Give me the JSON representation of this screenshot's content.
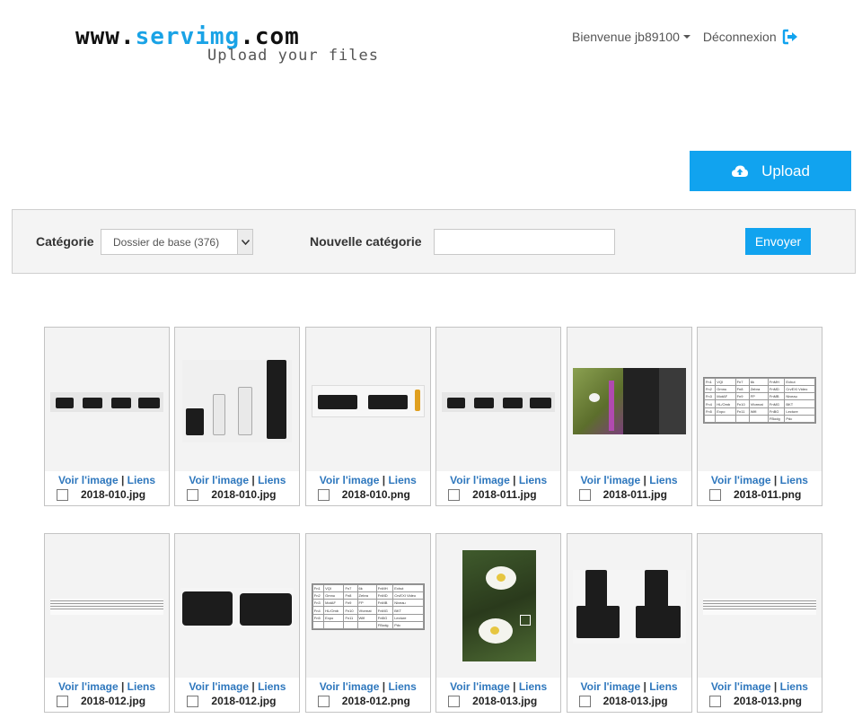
{
  "brand": {
    "prefix": "www.",
    "name": "servimg",
    "suffix": ".com",
    "tagline": "Upload your files"
  },
  "nav": {
    "welcome": "Bienvenue jb89100",
    "logout": "Déconnexion"
  },
  "upload": {
    "label": "Upload"
  },
  "category_panel": {
    "category_label": "Catégorie",
    "selected_category": "Dossier de base (376)",
    "new_category_label": "Nouvelle catégorie",
    "new_category_value": "",
    "send_label": "Envoyer"
  },
  "card_labels": {
    "view": "Voir l'image",
    "separator": "|",
    "links": "Liens"
  },
  "files": [
    {
      "name": "2018-010.jpg",
      "thumb": "cameras-row"
    },
    {
      "name": "2018-010.jpg",
      "thumb": "lenses"
    },
    {
      "name": "2018-010.png",
      "thumb": "cameras-top"
    },
    {
      "name": "2018-011.jpg",
      "thumb": "cameras-row"
    },
    {
      "name": "2018-011.jpg",
      "thumb": "butterfly-screen"
    },
    {
      "name": "2018-011.png",
      "thumb": "table"
    },
    {
      "name": "2018-012.jpg",
      "thumb": "text-table"
    },
    {
      "name": "2018-012.jpg",
      "thumb": "two-cameras"
    },
    {
      "name": "2018-012.png",
      "thumb": "table"
    },
    {
      "name": "2018-013.jpg",
      "thumb": "flowers"
    },
    {
      "name": "2018-013.jpg",
      "thumb": "cameras-lenses"
    },
    {
      "name": "2018-013.png",
      "thumb": "text-table"
    }
  ],
  "thumb_table_cells": [
    [
      "Fn1",
      "VQI",
      "Fn7",
      "6k",
      "FnMH",
      "Exhut"
    ],
    [
      "Fn2",
      "Gmnu",
      "Fn8",
      "Zebra",
      "FnMD",
      "CrvEXI Video"
    ],
    [
      "Fn3",
      "MotAF",
      "Fn9",
      "FP",
      "FnMB",
      "Niveau"
    ],
    [
      "Fn4",
      "HL/Omb",
      "Fn10",
      "Vformat",
      "FnMG",
      "BKT"
    ],
    [
      "Fn5",
      "Expo",
      "Fn11",
      "Wifi",
      "FnBG",
      "Lecture"
    ],
    [
      "",
      "",
      "",
      "",
      "FBodg",
      "Pdc"
    ]
  ],
  "colors": {
    "accent": "#11a3ef",
    "link": "#2e77bd",
    "panel_bg": "#f4f4f4"
  }
}
